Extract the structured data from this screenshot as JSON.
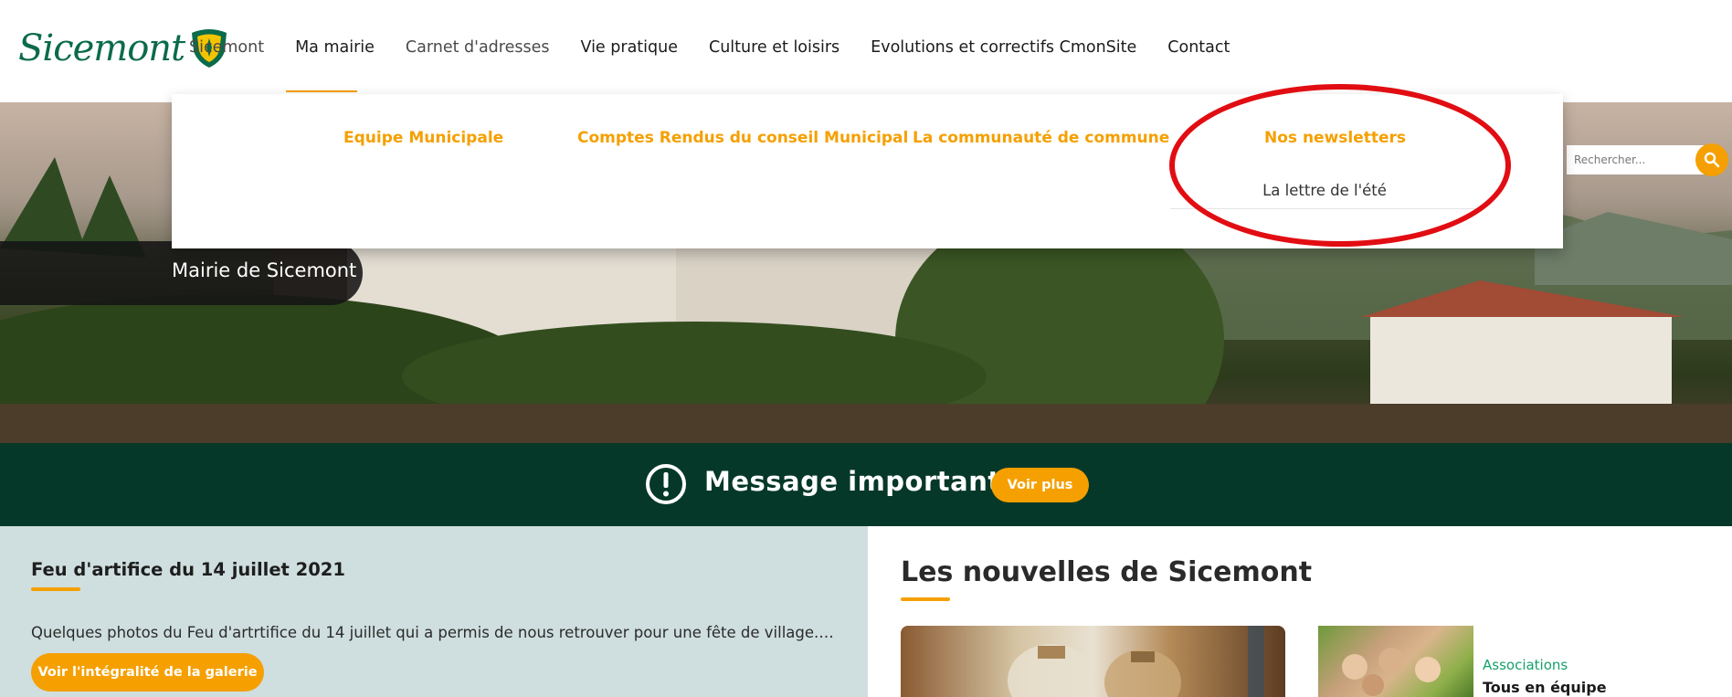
{
  "brand": {
    "logo_text": "Sicemont"
  },
  "nav": {
    "items": [
      {
        "label": "Sicemont"
      },
      {
        "label": "Ma mairie"
      },
      {
        "label": "Carnet d'adresses"
      },
      {
        "label": "Vie pratique"
      },
      {
        "label": "Culture et loisirs"
      },
      {
        "label": "Evolutions et correctifs CmonSite"
      },
      {
        "label": "Contact"
      }
    ]
  },
  "dropdown": {
    "columns": [
      {
        "label": "Equipe Municipale"
      },
      {
        "label": "Comptes Rendus du conseil Municipal"
      },
      {
        "label": "La communauté de commune"
      },
      {
        "label": "Nos newsletters"
      }
    ],
    "sub_item": "La lettre de l'été"
  },
  "hero": {
    "title": "Mairie de Sicemont"
  },
  "search": {
    "placeholder": "Rechercher..."
  },
  "message": {
    "text": "Message important",
    "button": "Voir plus"
  },
  "gallery": {
    "title": "Feu d'artifice du 14 juillet 2021",
    "excerpt": "Quelques photos du Feu d'artrtifice du 14 juillet qui a permis de nous retrouver pour une fête de village.…",
    "button": "Voir l'intégralité de la galerie"
  },
  "news": {
    "title": "Les nouvelles de Sicemont",
    "item_category": "Associations",
    "item_title": "Tous en équipe"
  },
  "colors": {
    "accent": "#f5a000",
    "dark_green": "#053828",
    "brand_green": "#0b6b4a",
    "annotation_red": "#e10d12"
  }
}
